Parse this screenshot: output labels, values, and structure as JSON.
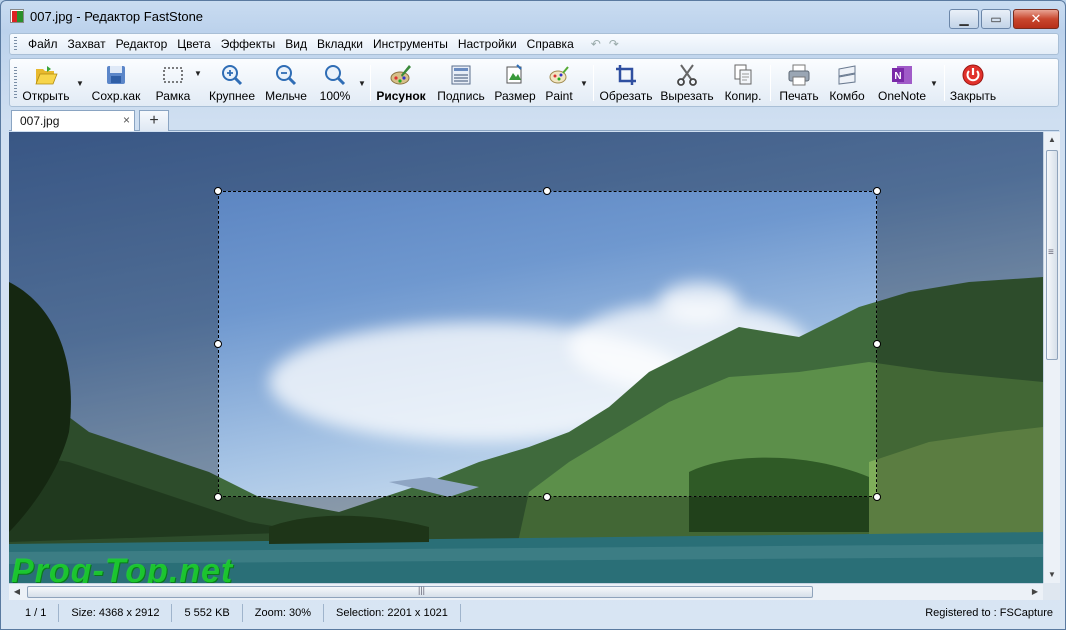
{
  "window": {
    "title": "007.jpg - Редактор FastStone"
  },
  "menu": [
    "Файл",
    "Захват",
    "Редактор",
    "Цвета",
    "Эффекты",
    "Вид",
    "Вкладки",
    "Инструменты",
    "Настройки",
    "Справка"
  ],
  "toolbar": {
    "open": "Открыть",
    "save_as": "Сохр.как",
    "frame": "Рамка",
    "zoom_in": "Крупнее",
    "zoom_out": "Мельче",
    "zoom_100": "100%",
    "draw": "Рисунок",
    "caption": "Подпись",
    "resize": "Размер",
    "paint": "Paint",
    "crop": "Обрезать",
    "cut": "Вырезать",
    "copy": "Копир.",
    "print": "Печать",
    "combo": "Комбо",
    "onenote": "OneNote",
    "close": "Закрыть"
  },
  "tabs": {
    "active": "007.jpg",
    "close_glyph": "×",
    "add_glyph": "+"
  },
  "watermark": "Prog-Top.net",
  "status": {
    "page": "1 / 1",
    "size": "Size: 4368 x 2912",
    "filesize": "5 552 KB",
    "zoom": "Zoom: 30%",
    "selection": "Selection: 2201 x 1021",
    "registered": "Registered to : FSCapture"
  },
  "colors": {
    "accent": "#2f6db5",
    "close_red": "#c9472e",
    "watermark": "#1ed232"
  }
}
